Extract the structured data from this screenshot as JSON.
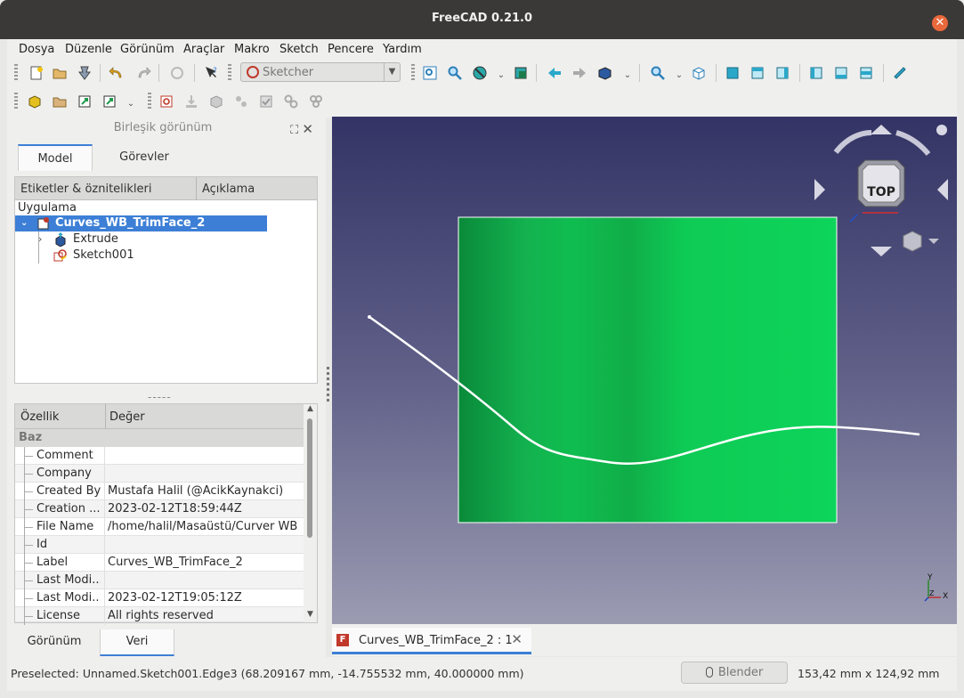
{
  "window": {
    "title": "FreeCAD 0.21.0",
    "close_glyph": "✕"
  },
  "menu": [
    {
      "label": "Dosya"
    },
    {
      "label": "Düzenle"
    },
    {
      "label": "Görünüm"
    },
    {
      "label": "Araçlar"
    },
    {
      "label": "Makro"
    },
    {
      "label": "Sketch"
    },
    {
      "label": "Pencere"
    },
    {
      "label": "Yardım"
    }
  ],
  "toolbar": {
    "workbench": "Sketcher"
  },
  "combo_view": {
    "title": "Birleşik görünüm",
    "tabs": {
      "model": "Model",
      "tasks": "Görevler"
    },
    "tree": {
      "col_labels": "Etiketler & öznitelikleri",
      "col_desc": "Açıklama",
      "root": "Uygulama",
      "document": "Curves_WB_TrimFace_2",
      "items": [
        "Extrude",
        "Sketch001"
      ]
    },
    "splitter": "-----",
    "properties": {
      "col_prop": "Özellik",
      "col_value": "Değer",
      "group": "Baz",
      "rows": [
        {
          "key": "Comment",
          "value": ""
        },
        {
          "key": "Company",
          "value": ""
        },
        {
          "key": "Created By",
          "value": "Mustafa Halil (@AcikKaynakci)"
        },
        {
          "key": "Creation ...",
          "value": "2023-02-12T18:59:44Z"
        },
        {
          "key": "File Name",
          "value": "/home/halil/Masaüstü/Curver WB ..."
        },
        {
          "key": "Id",
          "value": ""
        },
        {
          "key": "Label",
          "value": "Curves_WB_TrimFace_2"
        },
        {
          "key": "Last Modi...",
          "value": ""
        },
        {
          "key": "Last Modi...",
          "value": "2023-02-12T19:05:12Z"
        },
        {
          "key": "License",
          "value": "All rights reserved"
        }
      ]
    },
    "bottom_tabs": {
      "view": "Görünüm",
      "data": "Veri"
    }
  },
  "viewport": {
    "navcube_face": "TOP",
    "axis_y": "Y",
    "axis_x": "X",
    "axis_z": "Z",
    "tab_label": "Curves_WB_TrimFace_2 : 1",
    "face_color": "#0ecb55"
  },
  "status": {
    "preselected": "Preselected: Unnamed.Sketch001.Edge3 (68.209167 mm, -14.755532 mm, 40.000000 mm)",
    "nav_style": "Blender",
    "dimensions": "153,42 mm x 124,92 mm"
  }
}
